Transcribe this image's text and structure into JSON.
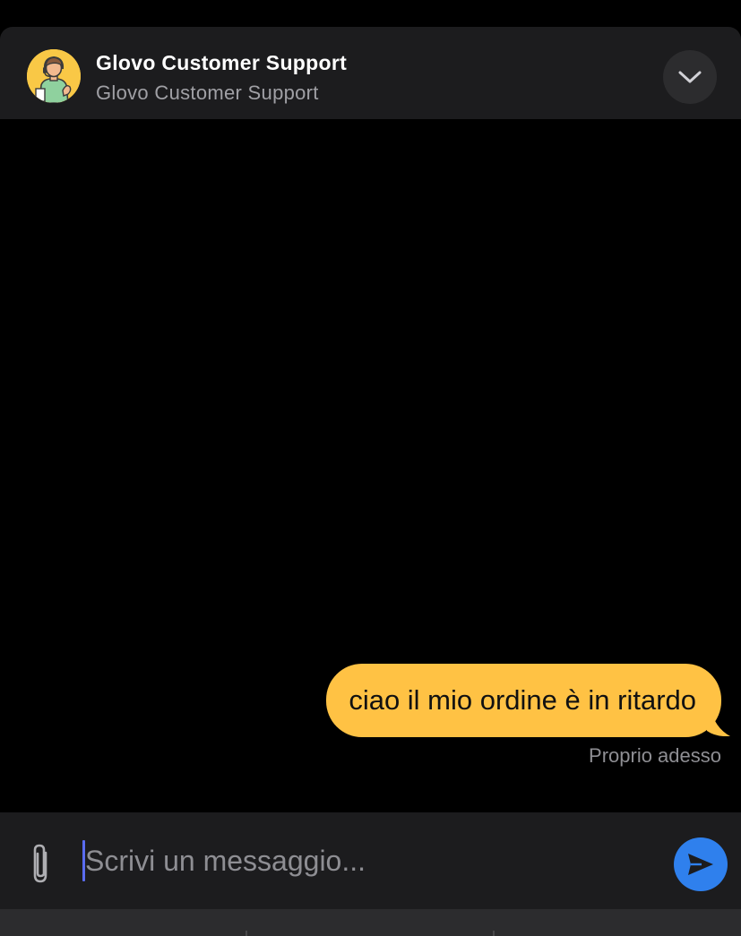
{
  "header": {
    "title": "Glovo Customer Support",
    "subtitle": "Glovo Customer Support",
    "avatar_icon": "support-agent-avatar",
    "collapse_icon": "chevron-down-icon"
  },
  "messages": [
    {
      "direction": "outgoing",
      "text": "ciao il mio ordine è in ritardo",
      "timestamp": "Proprio adesso"
    }
  ],
  "composer": {
    "placeholder": "Scrivi un messaggio...",
    "value": "",
    "attach_icon": "paperclip-icon",
    "send_icon": "send-icon"
  },
  "colors": {
    "background": "#000000",
    "header_bg": "#1c1c1e",
    "bubble_bg": "#ffc244",
    "send_button": "#2f80ed",
    "avatar_bg": "#f9c846"
  }
}
